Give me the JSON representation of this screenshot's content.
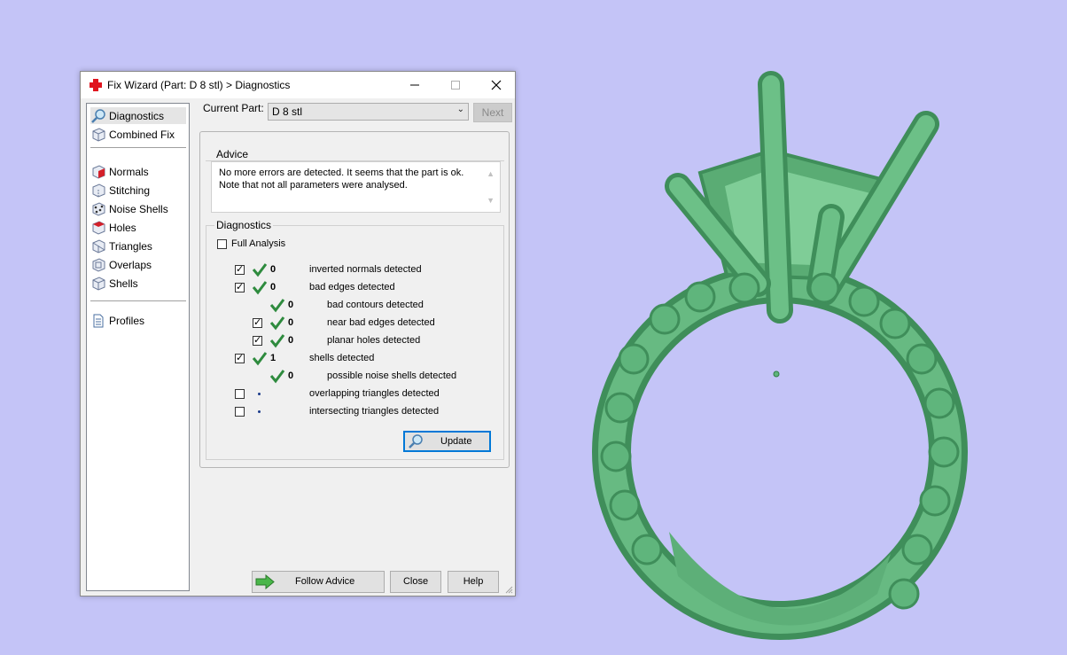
{
  "window": {
    "title": "Fix Wizard (Part: D 8 stl) > Diagnostics"
  },
  "nav": {
    "items": [
      {
        "label": "Diagnostics",
        "icon": "magnifier-icon"
      },
      {
        "label": "Combined Fix",
        "icon": "cube-icon"
      },
      {
        "label": "Normals",
        "icon": "normals-cube-icon"
      },
      {
        "label": "Stitching",
        "icon": "stitching-cube-icon"
      },
      {
        "label": "Noise Shells",
        "icon": "noise-shells-icon"
      },
      {
        "label": "Holes",
        "icon": "holes-cube-icon"
      },
      {
        "label": "Triangles",
        "icon": "triangles-icon"
      },
      {
        "label": "Overlaps",
        "icon": "overlaps-cube-icon"
      },
      {
        "label": "Shells",
        "icon": "shells-cube-icon"
      },
      {
        "label": "Profiles",
        "icon": "document-icon"
      }
    ]
  },
  "current_part": {
    "label": "Current Part:",
    "value": "D 8 stl"
  },
  "buttons": {
    "next": "Next",
    "update": "Update",
    "follow_advice": "Follow Advice",
    "close": "Close",
    "help": "Help"
  },
  "advice": {
    "label": "Advice",
    "line1": "No more errors are detected. It seems that the part is ok.",
    "line2": "Note that not all parameters were analysed."
  },
  "diagnostics": {
    "label": "Diagnostics",
    "full_analysis": "Full Analysis",
    "rows": [
      {
        "count": "0",
        "text": "inverted normals detected",
        "checked": true,
        "status": "ok"
      },
      {
        "count": "0",
        "text": "bad edges detected",
        "checked": true,
        "status": "ok"
      },
      {
        "count": "0",
        "text": "bad contours detected",
        "status": "ok"
      },
      {
        "count": "0",
        "text": "near bad edges detected",
        "checked": true,
        "status": "ok"
      },
      {
        "count": "0",
        "text": "planar holes detected",
        "checked": true,
        "status": "ok"
      },
      {
        "count": "1",
        "text": "shells detected",
        "checked": true,
        "status": "ok"
      },
      {
        "count": "0",
        "text": "possible noise shells detected",
        "status": "ok"
      },
      {
        "count": "",
        "text": "overlapping triangles detected",
        "checked": false,
        "status": "not-run"
      },
      {
        "count": "",
        "text": "intersecting triangles detected",
        "checked": false,
        "status": "not-run"
      }
    ]
  },
  "colors": {
    "viewport_background": "#c4c4f7",
    "model_green": "#5fb57c",
    "check_green": "#2e8b3e",
    "focus_blue": "#0078d7"
  }
}
